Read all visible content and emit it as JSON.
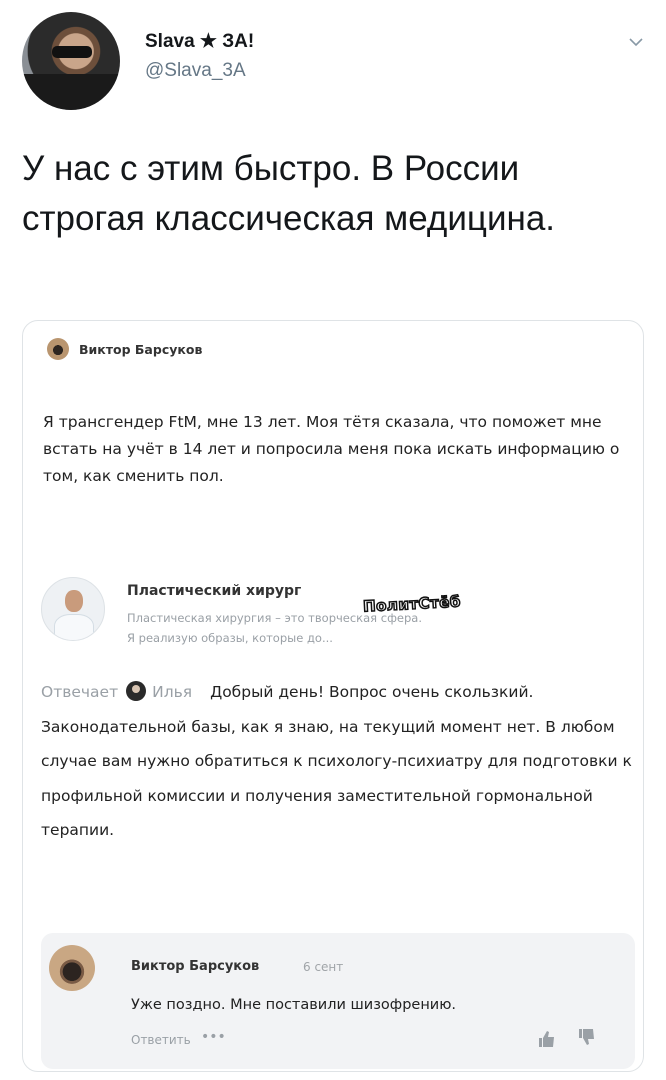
{
  "tweet": {
    "display_name": "Slava ★ ЗА!",
    "handle": "@Slava_3A",
    "text": "У нас с этим быстро. В России строгая классическая медицина."
  },
  "quoted_post": {
    "author": "Виктор Барсуков",
    "question": "Я трансгендер FtM, мне 13 лет. Моя тётя сказала, что поможет мне встать на учёт в 14 лет и попросила меня пока искать информацию о том, как сменить пол.",
    "answerer": {
      "name": "Пластический хирург",
      "desc_line1": "Пластическая хирургия – это творческая сфера.",
      "desc_line2": "Я реализую образы, которые до..."
    },
    "watermark": "ПолитСтёб",
    "answer": {
      "prefix": "Отвечает",
      "reply_to": "Илья",
      "text": "Добрый день! Вопрос очень скользкий. Законодательной базы, как я знаю, на текущий момент нет. В любом случае вам нужно обратиться к психологу-психиатру для подготовки к профильной комиссии и получения заместительной гормональной терапии."
    },
    "comment": {
      "author": "Виктор Барсуков",
      "date": "6 сент",
      "text": "Уже поздно. Мне поставили шизофрению.",
      "reply_label": "Ответить",
      "more_label": "•••"
    }
  },
  "icons": [
    "avatar",
    "caret-down-icon",
    "reply-user-icon",
    "like-icon",
    "dislike-icon"
  ]
}
